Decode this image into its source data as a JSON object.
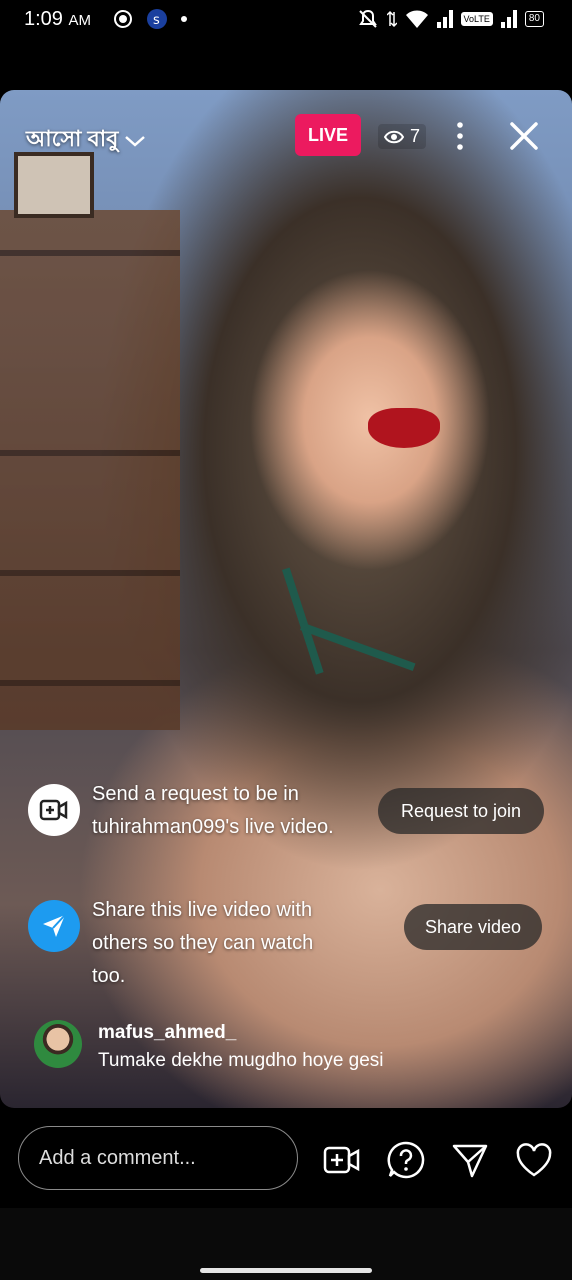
{
  "status_bar": {
    "time": "1:09",
    "ampm": "AM",
    "network_label": "VoLTE",
    "battery": "80"
  },
  "header": {
    "username": "আসো বাবু",
    "live_label": "LIVE",
    "viewer_count": "7"
  },
  "requests": {
    "join_text": "Send a request to be in tuhirahman099's live video.",
    "join_button": "Request to join",
    "share_text": "Share this live video with others so they can watch too.",
    "share_button": "Share video"
  },
  "comment": {
    "username": "mafus_ahmed_",
    "text": "Tumake dekhe mugdho hoye gesi"
  },
  "bottom_bar": {
    "comment_placeholder": "Add a comment...",
    "icons": [
      "add-video-icon",
      "question-icon",
      "send-icon",
      "heart-icon"
    ]
  },
  "colors": {
    "live_badge": "#ec1a5f",
    "share_icon_bg": "#1d9bf0",
    "join_icon_bg": "#ffffff"
  }
}
